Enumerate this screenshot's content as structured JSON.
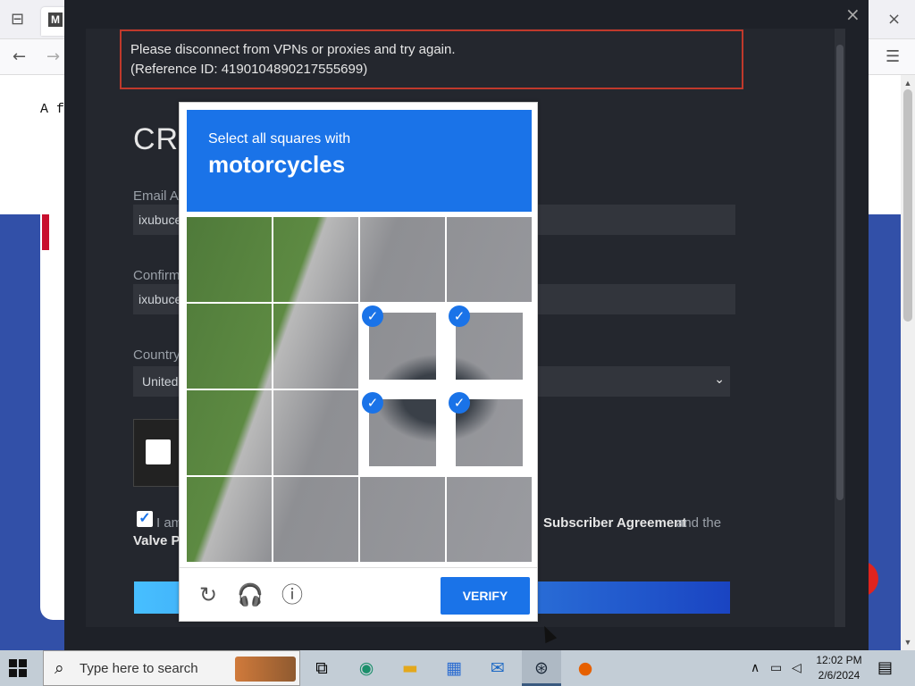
{
  "browser": {
    "page_text": "A f",
    "close_icon": "×",
    "menu_icon": "☰"
  },
  "modal": {
    "error_line1": "Please disconnect from VPNs or proxies and try again.",
    "error_line2": "(Reference ID: 4190104890217555699)",
    "title": "CRI",
    "email_label": "Email Ad",
    "email_value": "ixubuce",
    "confirm_label": "Confirm",
    "confirm_value": "ixubuce",
    "country_label": "Country",
    "country_value": "United",
    "agree_text": "I am",
    "agree_link": "Subscriber Agreement",
    "agree_and": "and the",
    "agree_valve": "Valve Pr"
  },
  "captcha": {
    "instruction": "Select all squares with",
    "target": "motorcycles",
    "verify_label": "VERIFY",
    "tiles": [
      {
        "selected": false
      },
      {
        "selected": false
      },
      {
        "selected": false
      },
      {
        "selected": false
      },
      {
        "selected": false
      },
      {
        "selected": false
      },
      {
        "selected": true
      },
      {
        "selected": true
      },
      {
        "selected": false
      },
      {
        "selected": false
      },
      {
        "selected": true
      },
      {
        "selected": true
      },
      {
        "selected": false
      },
      {
        "selected": false
      },
      {
        "selected": false
      },
      {
        "selected": false
      }
    ]
  },
  "taskbar": {
    "search_placeholder": "Type here to search",
    "time": "12:02 PM",
    "date": "2/6/2024"
  },
  "colors": {
    "captcha_blue": "#1a73e8",
    "modal_bg": "#1e2128",
    "error_border": "#c0392b"
  }
}
